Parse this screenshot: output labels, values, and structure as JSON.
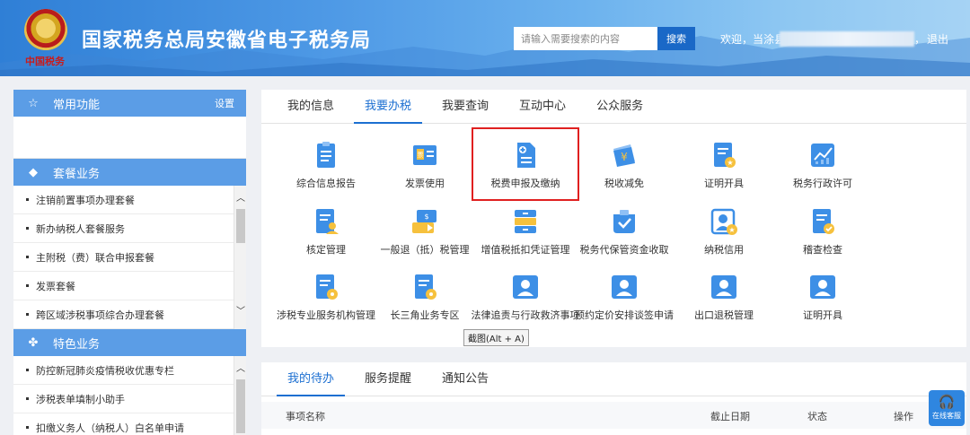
{
  "header": {
    "title": "国家税务总局安徽省电子税务局",
    "emblem_caption": "中国税务",
    "search_placeholder": "请输入需要搜索的内容",
    "search_button": "搜索",
    "welcome": "欢迎，当涂县",
    "comma": "，",
    "logout": "退出"
  },
  "sidebar": {
    "common": {
      "title": "常用功能",
      "settings": "设置"
    },
    "package": {
      "title": "套餐业务",
      "items": [
        "注销前置事项办理套餐",
        "新办纳税人套餐服务",
        "主附税（费）联合申报套餐",
        "发票套餐",
        "跨区域涉税事项综合办理套餐"
      ]
    },
    "feature": {
      "title": "特色业务",
      "items": [
        "防控新冠肺炎疫情税收优惠专栏",
        "涉税表单填制小助手",
        "扣缴义务人（纳税人）白名单申请"
      ]
    }
  },
  "main": {
    "tabs": [
      "我的信息",
      "我要办税",
      "我要查询",
      "互动中心",
      "公众服务"
    ],
    "active_tab": "我要办税",
    "tiles": [
      {
        "label": "综合信息报告",
        "icon": "report-doc-icon"
      },
      {
        "label": "发票使用",
        "icon": "invoice-icon"
      },
      {
        "label": "税费申报及缴纳",
        "icon": "tax-declare-icon"
      },
      {
        "label": "税收减免",
        "icon": "tax-relief-icon"
      },
      {
        "label": "证明开具",
        "icon": "certificate-icon"
      },
      {
        "label": "税务行政许可",
        "icon": "admin-license-icon"
      },
      {
        "label": "核定管理",
        "icon": "assess-manage-icon"
      },
      {
        "label": "一般退（抵）税管理",
        "icon": "tax-refund-icon"
      },
      {
        "label": "增值税抵扣凭证管理",
        "icon": "vat-voucher-icon"
      },
      {
        "label": "税务代保管资金收取",
        "icon": "custody-fund-icon"
      },
      {
        "label": "纳税信用",
        "icon": "tax-credit-icon"
      },
      {
        "label": "稽查检查",
        "icon": "inspection-icon"
      },
      {
        "label": "涉税专业服务机构管理",
        "icon": "agency-manage-icon"
      },
      {
        "label": "长三角业务专区",
        "icon": "yangtze-zone-icon"
      },
      {
        "label": "法律追责与行政救济事项",
        "icon": "legal-relief-icon"
      },
      {
        "label": "预约定价安排谈签申请",
        "icon": "pricing-apply-icon"
      },
      {
        "label": "出口退税管理",
        "icon": "export-refund-icon"
      },
      {
        "label": "证明开具",
        "icon": "certificate2-icon"
      }
    ],
    "tooltip": "截图(Alt + A)"
  },
  "todo": {
    "tabs": [
      "我的待办",
      "服务提醒",
      "通知公告"
    ],
    "active_tab": "我的待办",
    "columns": [
      "事项名称",
      "截止日期",
      "状态",
      "操作"
    ]
  },
  "service": {
    "label": "在线客服"
  },
  "colors": {
    "accent": "#1c6fd1",
    "sidebar_head": "#5b9de6",
    "highlight": "#e02020"
  }
}
